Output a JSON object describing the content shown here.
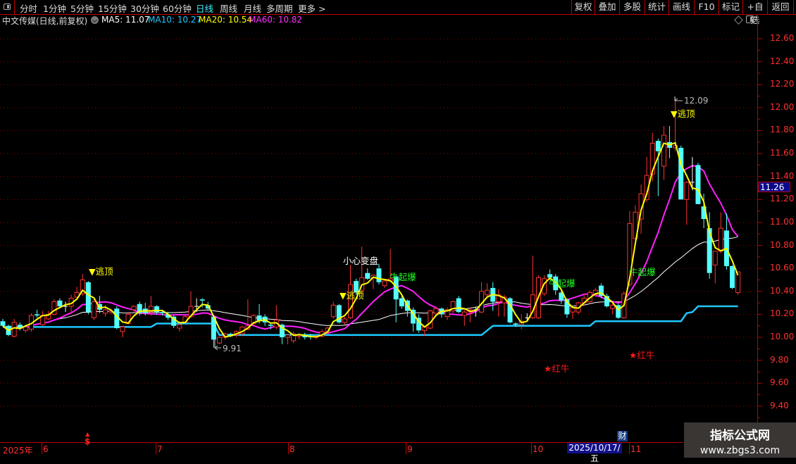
{
  "toolbar": {
    "periods": [
      "分时",
      "1分钟",
      "5分钟",
      "15分钟",
      "30分钟",
      "60分钟",
      "日线",
      "周线",
      "月线",
      "多周期",
      "更多 >"
    ],
    "active_period": "日线",
    "right_buttons": [
      "复权",
      "叠加",
      "多股",
      "统计",
      "画线",
      "F10",
      "标记",
      "+自选",
      "返回"
    ]
  },
  "legend": {
    "title": "中文传媒(日线,前复权)",
    "ma5": "MA5: 11.07",
    "ma10": "MA10: 10.27",
    "ma20": "MA20: 10.54",
    "ma60": "MA60: 10.82"
  },
  "colors": {
    "up": "#ff3232",
    "down": "#54ffff",
    "ma5_legend": "#ffffff",
    "ma10": "#1ec8ff",
    "ma20": "#ffff00",
    "ma60": "#ff30ff",
    "short_line": "#ffff00",
    "mid_line": "#ff20ff",
    "long_line": "#ffffff",
    "support_line": "#1ec8ff",
    "grid": "#8a0000",
    "axis": "#ff3030"
  },
  "axis": {
    "price_labels": [
      "12.60",
      "12.40",
      "12.20",
      "12.00",
      "11.80",
      "11.60",
      "11.40",
      "11.20",
      "11.00",
      "10.80",
      "10.60",
      "10.40",
      "10.20",
      "10.00",
      "9.80",
      "9.60",
      "9.40"
    ],
    "current_price": "11.26",
    "dates": [
      "2025年",
      "6",
      "7",
      "8",
      "9",
      "10",
      "11"
    ],
    "cursor_date": "2025/10/17/五",
    "finance_marker": "财",
    "s_marker": "$"
  },
  "annotations": {
    "escape_top": "▼逃顶",
    "caution": "小心变盘",
    "bull_burst": "牛起爆",
    "red_bull": "★红牛",
    "low": "9.91",
    "high": "12.09"
  },
  "watermark": {
    "title": "指标公式网",
    "url": "www.zbgs3.com"
  },
  "chart_data": {
    "type": "candlestick",
    "ylim": [
      9.3,
      12.7
    ],
    "yticks": [
      12.6,
      12.4,
      12.2,
      12.0,
      11.8,
      11.6,
      11.4,
      11.2,
      11.0,
      10.8,
      10.6,
      10.4,
      10.2,
      10.0,
      9.8,
      9.6,
      9.4
    ],
    "grid": true,
    "x_months": [
      "6",
      "7",
      "8",
      "9",
      "10",
      "11"
    ],
    "ohlc": [
      [
        10.14,
        10.16,
        10.09,
        10.1
      ],
      [
        10.1,
        10.11,
        10.01,
        10.02
      ],
      [
        10.01,
        10.16,
        10.0,
        10.13
      ],
      [
        10.11,
        10.13,
        10.06,
        10.08
      ],
      [
        10.06,
        10.11,
        10.04,
        10.09
      ],
      [
        10.07,
        10.21,
        10.05,
        10.19
      ],
      [
        10.2,
        10.24,
        10.17,
        10.19
      ],
      [
        10.11,
        10.23,
        10.1,
        10.19
      ],
      [
        10.16,
        10.23,
        10.15,
        10.2
      ],
      [
        10.2,
        10.33,
        10.19,
        10.31
      ],
      [
        10.32,
        10.34,
        10.25,
        10.27
      ],
      [
        10.27,
        10.31,
        10.22,
        10.27
      ],
      [
        10.27,
        10.37,
        10.21,
        10.34
      ],
      [
        10.35,
        10.44,
        10.33,
        10.39
      ],
      [
        10.38,
        10.55,
        10.36,
        10.5
      ],
      [
        10.48,
        10.49,
        10.2,
        10.22
      ],
      [
        10.17,
        10.33,
        10.15,
        10.31
      ],
      [
        10.29,
        10.36,
        10.21,
        10.24
      ],
      [
        10.21,
        10.28,
        10.18,
        10.24
      ],
      [
        10.22,
        10.25,
        10.2,
        10.23
      ],
      [
        10.25,
        10.27,
        10.07,
        10.08
      ],
      [
        10.05,
        10.1,
        10.0,
        10.09
      ],
      [
        10.12,
        10.22,
        10.11,
        10.2
      ],
      [
        10.24,
        10.28,
        10.22,
        10.27
      ],
      [
        10.29,
        10.31,
        10.19,
        10.21
      ],
      [
        10.25,
        10.3,
        10.19,
        10.21
      ],
      [
        10.22,
        10.36,
        10.19,
        10.27
      ],
      [
        10.27,
        10.28,
        10.2,
        10.22
      ],
      [
        10.22,
        10.24,
        10.19,
        10.21
      ],
      [
        10.2,
        10.22,
        10.15,
        10.17
      ],
      [
        10.18,
        10.19,
        10.08,
        10.1
      ],
      [
        10.08,
        10.14,
        10.05,
        10.11
      ],
      [
        10.13,
        10.19,
        10.12,
        10.18
      ],
      [
        10.18,
        10.4,
        10.17,
        10.27
      ],
      [
        10.27,
        10.34,
        10.22,
        10.27
      ],
      [
        10.33,
        10.34,
        10.26,
        10.32
      ],
      [
        10.28,
        10.31,
        10.24,
        10.25
      ],
      [
        10.18,
        10.19,
        9.91,
        9.98
      ],
      [
        9.95,
        10.01,
        9.94,
        10.0
      ],
      [
        10.0,
        10.04,
        9.98,
        10.03
      ],
      [
        10.03,
        10.04,
        10.0,
        10.01
      ],
      [
        10.02,
        10.06,
        10.0,
        10.05
      ],
      [
        10.03,
        10.1,
        10.01,
        10.09
      ],
      [
        10.07,
        10.33,
        10.06,
        10.1
      ],
      [
        10.12,
        10.2,
        10.1,
        10.19
      ],
      [
        10.19,
        10.29,
        10.12,
        10.14
      ],
      [
        10.18,
        10.2,
        10.1,
        10.13
      ],
      [
        10.11,
        10.13,
        10.07,
        10.1
      ],
      [
        10.09,
        10.28,
        10.07,
        10.15
      ],
      [
        10.11,
        10.12,
        9.94,
        10.0
      ],
      [
        10.0,
        10.03,
        9.94,
        10.02
      ],
      [
        9.97,
        10.05,
        9.95,
        10.03
      ],
      [
        10.01,
        10.04,
        9.98,
        10.02
      ],
      [
        10.02,
        10.04,
        9.98,
        10.0
      ],
      [
        10.01,
        10.03,
        9.98,
        10.0
      ],
      [
        10.0,
        10.02,
        9.98,
        10.01
      ],
      [
        10.01,
        10.07,
        10.0,
        10.05
      ],
      [
        10.05,
        10.09,
        10.03,
        10.08
      ],
      [
        10.18,
        10.31,
        10.16,
        10.28
      ],
      [
        10.28,
        10.29,
        10.12,
        10.13
      ],
      [
        10.13,
        10.18,
        10.11,
        10.16
      ],
      [
        10.17,
        10.63,
        10.16,
        10.46
      ],
      [
        10.49,
        10.51,
        10.37,
        10.39
      ],
      [
        10.41,
        10.79,
        10.4,
        10.52
      ],
      [
        10.56,
        10.6,
        10.5,
        10.51
      ],
      [
        10.52,
        10.55,
        10.42,
        10.54
      ],
      [
        10.6,
        10.64,
        10.46,
        10.48
      ],
      [
        10.45,
        10.5,
        10.43,
        10.49
      ],
      [
        10.49,
        10.77,
        10.48,
        10.51
      ],
      [
        10.53,
        10.54,
        10.13,
        10.33
      ],
      [
        10.34,
        10.36,
        10.25,
        10.27
      ],
      [
        10.32,
        10.33,
        10.18,
        10.23
      ],
      [
        10.24,
        10.26,
        10.05,
        10.12
      ],
      [
        10.17,
        10.2,
        10.04,
        10.06
      ],
      [
        10.06,
        10.1,
        10.01,
        10.09
      ],
      [
        10.08,
        10.24,
        10.07,
        10.23
      ],
      [
        10.21,
        10.27,
        10.19,
        10.25
      ],
      [
        10.25,
        10.26,
        10.17,
        10.2
      ],
      [
        10.18,
        10.26,
        10.15,
        10.24
      ],
      [
        10.23,
        10.32,
        10.21,
        10.31
      ],
      [
        10.34,
        10.36,
        10.21,
        10.22
      ],
      [
        10.19,
        10.24,
        10.1,
        10.22
      ],
      [
        10.22,
        10.26,
        10.13,
        10.24
      ],
      [
        10.24,
        10.26,
        10.18,
        10.24
      ],
      [
        10.22,
        10.48,
        10.21,
        10.4
      ],
      [
        10.37,
        10.47,
        10.35,
        10.41
      ],
      [
        10.43,
        10.48,
        10.23,
        10.31
      ],
      [
        10.31,
        10.42,
        10.18,
        10.37
      ],
      [
        10.3,
        10.37,
        10.18,
        10.35
      ],
      [
        10.34,
        10.35,
        10.12,
        10.13
      ],
      [
        10.12,
        10.13,
        10.09,
        10.11
      ],
      [
        10.11,
        10.2,
        10.07,
        10.14
      ],
      [
        10.17,
        10.21,
        10.14,
        10.17
      ],
      [
        10.17,
        10.71,
        10.16,
        10.37
      ],
      [
        10.17,
        10.54,
        10.16,
        10.52
      ],
      [
        10.38,
        10.54,
        10.36,
        10.51
      ],
      [
        10.55,
        10.59,
        10.5,
        10.52
      ],
      [
        10.53,
        10.55,
        10.37,
        10.41
      ],
      [
        10.39,
        10.41,
        10.29,
        10.32
      ],
      [
        10.33,
        10.34,
        10.17,
        10.2
      ],
      [
        10.22,
        10.27,
        10.16,
        10.26
      ],
      [
        10.22,
        10.31,
        10.2,
        10.3
      ],
      [
        10.3,
        10.38,
        10.28,
        10.34
      ],
      [
        10.31,
        10.41,
        10.29,
        10.39
      ],
      [
        10.37,
        10.43,
        10.35,
        10.41
      ],
      [
        10.45,
        10.47,
        10.34,
        10.36
      ],
      [
        10.36,
        10.38,
        10.26,
        10.27
      ],
      [
        10.25,
        10.29,
        10.2,
        10.28
      ],
      [
        10.28,
        10.29,
        10.16,
        10.17
      ],
      [
        10.17,
        10.4,
        10.16,
        10.38
      ],
      [
        10.46,
        11.1,
        10.44,
        10.99
      ],
      [
        10.86,
        11.15,
        10.84,
        11.09
      ],
      [
        11.03,
        11.33,
        10.9,
        11.25
      ],
      [
        11.2,
        11.57,
        11.18,
        11.41
      ],
      [
        11.42,
        11.78,
        11.36,
        11.69
      ],
      [
        11.71,
        11.73,
        11.23,
        11.62
      ],
      [
        11.49,
        11.84,
        11.37,
        11.76
      ],
      [
        11.7,
        11.84,
        11.56,
        11.65
      ],
      [
        11.65,
        12.09,
        11.62,
        11.67
      ],
      [
        11.65,
        11.67,
        11.2,
        11.2
      ],
      [
        11.2,
        11.36,
        10.98,
        11.35
      ],
      [
        11.35,
        11.57,
        11.28,
        11.35
      ],
      [
        11.5,
        11.52,
        11.16,
        11.16
      ],
      [
        11.14,
        11.25,
        10.95,
        11.03
      ],
      [
        10.95,
        11.09,
        10.51,
        10.56
      ],
      [
        10.63,
        10.75,
        10.47,
        10.75
      ],
      [
        10.75,
        11.09,
        10.73,
        10.95
      ],
      [
        10.93,
        11.08,
        10.59,
        10.62
      ],
      [
        10.62,
        10.63,
        10.42,
        10.43
      ],
      [
        10.39,
        10.57,
        10.37,
        10.57
      ]
    ],
    "support_steps": [
      [
        0,
        10.09
      ],
      [
        26,
        10.09
      ],
      [
        27,
        10.12
      ],
      [
        37,
        10.12
      ],
      [
        38,
        10.02
      ],
      [
        84,
        10.02
      ],
      [
        86,
        10.1
      ],
      [
        103,
        10.1
      ],
      [
        104,
        10.14
      ],
      [
        119,
        10.14
      ],
      [
        120,
        10.21
      ],
      [
        121,
        10.22
      ],
      [
        122,
        10.27
      ],
      [
        129,
        10.27
      ]
    ]
  }
}
